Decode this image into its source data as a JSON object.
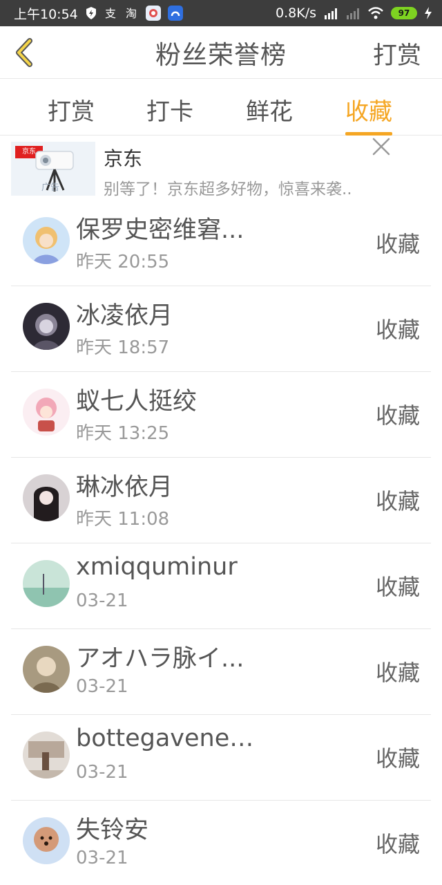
{
  "status_bar": {
    "time": "上午10:54",
    "net_speed": "0.8K/s",
    "battery": "97"
  },
  "header": {
    "title": "粉丝荣誉榜",
    "action": "打赏"
  },
  "tabs": [
    {
      "label": "打赏",
      "active": false
    },
    {
      "label": "打卡",
      "active": false
    },
    {
      "label": "鲜花",
      "active": false
    },
    {
      "label": "收藏",
      "active": true
    }
  ],
  "ad": {
    "title": "京东",
    "desc": "别等了！京东超多好物，惊喜来袭..",
    "tag": "广告",
    "logo": "京东"
  },
  "list": [
    {
      "name": "保罗史密维窘...",
      "time": "昨天 20:55",
      "action": "收藏",
      "avatar_color": "#f0c070"
    },
    {
      "name": "冰凌依月",
      "time": "昨天 18:57",
      "action": "收藏",
      "avatar_color": "#5a5566"
    },
    {
      "name": "蚁七人挺绞",
      "time": "昨天 13:25",
      "action": "收藏",
      "avatar_color": "#f2a8b8"
    },
    {
      "name": "琳冰依月",
      "time": "昨天 11:08",
      "action": "收藏",
      "avatar_color": "#3a3033"
    },
    {
      "name": "xmiqquminur",
      "time": "03-21",
      "action": "收藏",
      "avatar_color": "#8fc4b0"
    },
    {
      "name": "アオハラ脉イ...",
      "time": "03-21",
      "action": "收藏",
      "avatar_color": "#7a6a50"
    },
    {
      "name": "bottegaveneti...",
      "time": "03-21",
      "action": "收藏",
      "avatar_color": "#b8a89a"
    },
    {
      "name": "失铃安",
      "time": "03-21",
      "action": "收藏",
      "avatar_color": "#d49a78"
    }
  ]
}
